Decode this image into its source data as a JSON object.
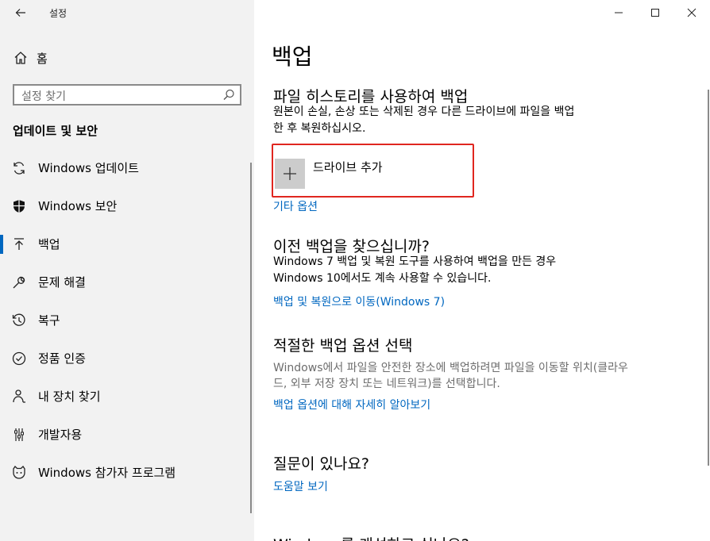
{
  "window": {
    "title": "설정",
    "back_glyph": "←"
  },
  "sidebar": {
    "home_label": "홈",
    "search_placeholder": "설정 찾기",
    "section_title": "업데이트 및 보안",
    "items": [
      {
        "label": "Windows 업데이트",
        "icon": "refresh-icon"
      },
      {
        "label": "Windows 보안",
        "icon": "shield-icon"
      },
      {
        "label": "백업",
        "icon": "backup-arrow-icon",
        "active": true
      },
      {
        "label": "문제 해결",
        "icon": "wrench-icon"
      },
      {
        "label": "복구",
        "icon": "history-icon"
      },
      {
        "label": "정품 인증",
        "icon": "check-circle-icon"
      },
      {
        "label": "내 장치 찾기",
        "icon": "person-location-icon"
      },
      {
        "label": "개발자용",
        "icon": "developer-tools-icon"
      },
      {
        "label": "Windows 참가자 프로그램",
        "icon": "insider-cat-icon"
      }
    ]
  },
  "main": {
    "title": "백업",
    "file_history": {
      "heading": "파일 히스토리를 사용하여 백업",
      "desc_line1": "원본이 손실, 손상 또는 삭제된 경우 다른 드라이브에 파일을 백업",
      "desc_line2": "한 후 복원하십시오.",
      "add_drive_label": "드라이브 추가",
      "add_drive_glyph": "+",
      "more_options_link": "기타 옵션"
    },
    "older_backup": {
      "heading": "이전 백업을 찾으십니까?",
      "desc_line1": "Windows 7 백업 및 복원 도구를 사용하여 백업을 만든 경우",
      "desc_line2": "Windows 10에서도 계속 사용할 수 있습니다.",
      "link": "백업 및 복원으로 이동(Windows 7)"
    },
    "right_option": {
      "heading": "적절한 백업 옵션 선택",
      "desc_line1": "Windows에서 파일을 안전한 장소에 백업하려면 파일을 이동할 위치(클라우",
      "desc_line2": "드, 외부 저장 장치 또는 네트워크)를 선택합니다.",
      "link": "백업 옵션에 대해 자세히 알아보기"
    },
    "question": {
      "heading": "질문이 있나요?",
      "link": "도움말 보기"
    },
    "cut_heading": "Windows를 개선하고 싶나요?"
  },
  "colors": {
    "accent": "#0067c0",
    "highlight_border": "#e0261f",
    "sidebar_bg": "#f2f2f2"
  }
}
